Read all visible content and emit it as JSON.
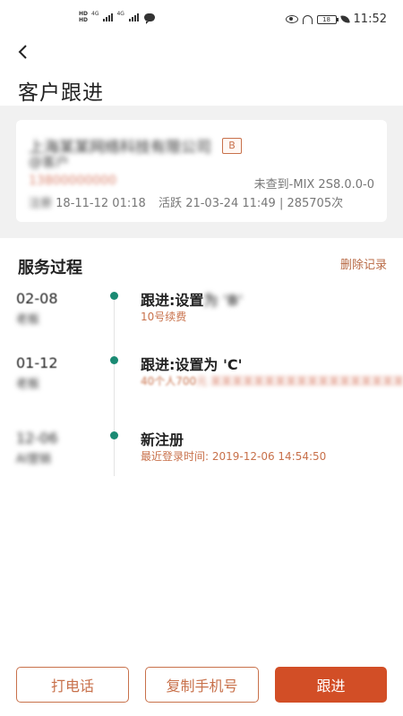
{
  "status_bar": {
    "hd_top": "HD",
    "hd_bottom": "HD",
    "net1": "4G",
    "net2": "4G",
    "battery": "18",
    "time": "11:52"
  },
  "header": {
    "title": "客户跟进"
  },
  "customer": {
    "company_name": "上海某某网络科技有限公司",
    "grade": "B",
    "wechat": "@客户",
    "phone": "13800000000",
    "device": "未查到-MIX 2S8.0.0-0",
    "register_label": "注册",
    "register_date": "18-11-12 01:18",
    "active_label": "活跃",
    "active_date": "21-03-24 11:49",
    "visit_count": "285705次"
  },
  "service": {
    "section_title": "服务过程",
    "delete_label": "删除记录",
    "items": [
      {
        "date": "02-08",
        "person": "老板",
        "title": "跟进:设置",
        "title_hidden": "为 'B'",
        "detail": "10号续费",
        "detail_hidden": ""
      },
      {
        "date": "01-12",
        "person": "老板",
        "title": "跟进:设置为 'C'",
        "title_hidden": "",
        "detail": "40个人700",
        "detail_hidden": "元 某某某某某某某某某某某某某某某某某某"
      },
      {
        "date": "12-06",
        "person": "AI营销",
        "title": "新注册",
        "title_hidden": "",
        "detail": "最近登录时间: 2019-12-06 14:54:50",
        "detail_hidden": ""
      }
    ]
  },
  "actions": {
    "call_label": "打电话",
    "copy_label": "复制手机号",
    "follow_label": "跟进"
  },
  "colors": {
    "accent": "#d24e26",
    "accent_text": "#c8714b",
    "timeline_dot": "#1a8a73",
    "band_gray": "#f1f1f1"
  }
}
